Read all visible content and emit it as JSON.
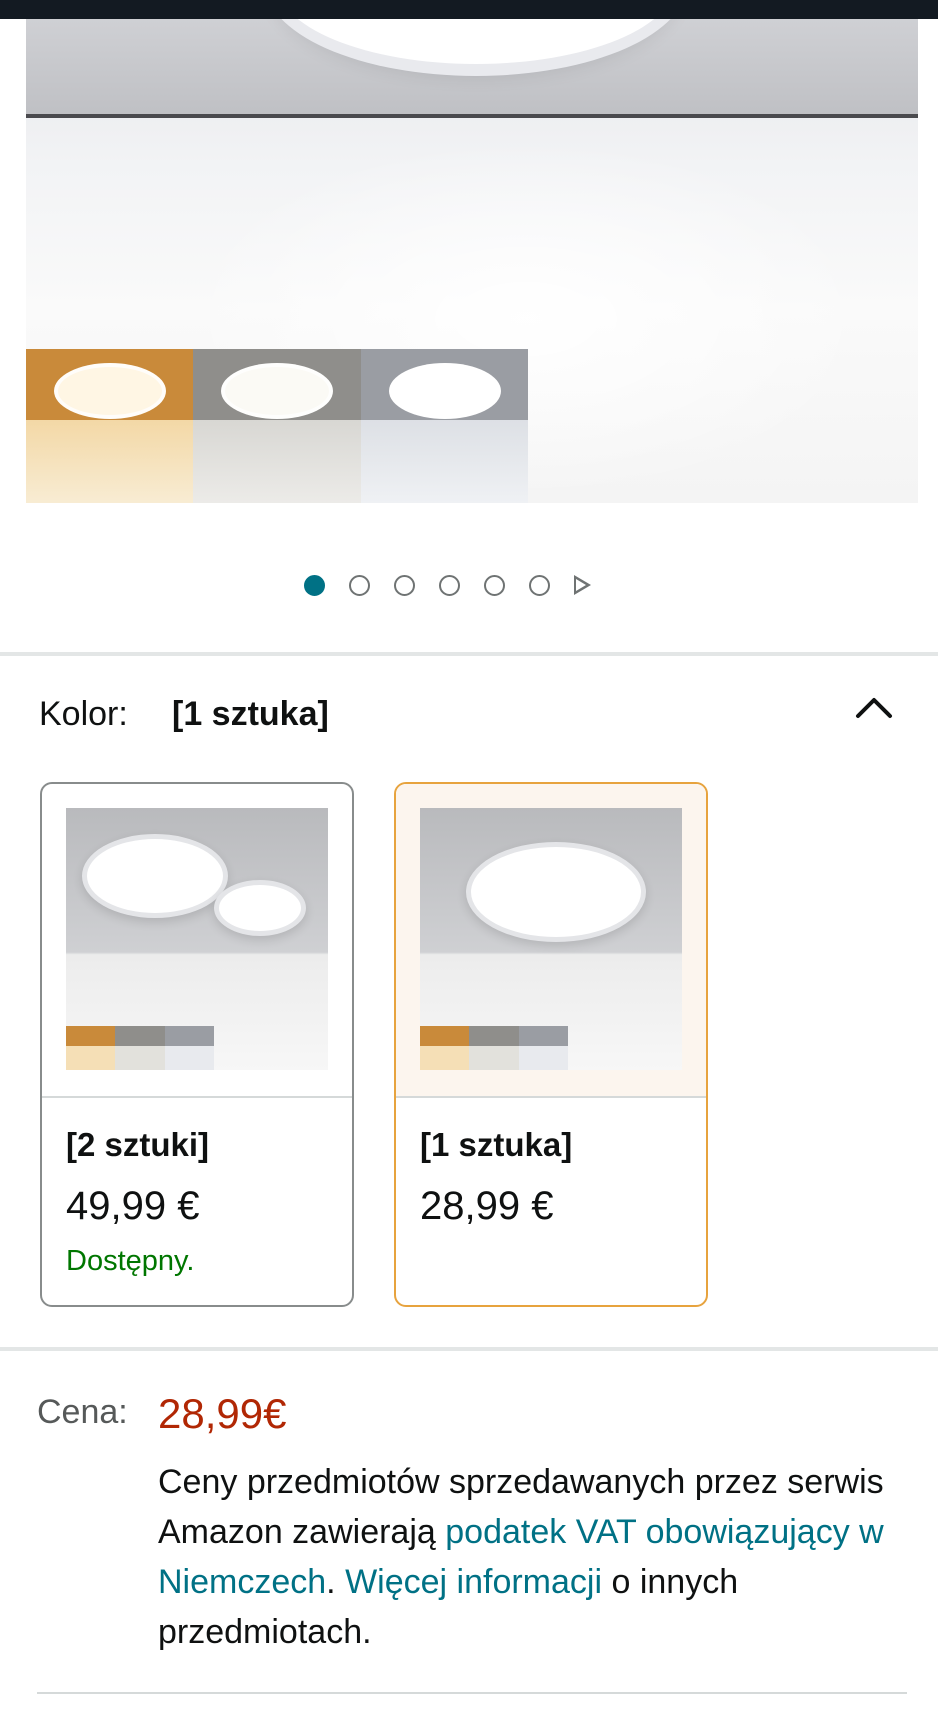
{
  "gallery": {
    "image_count": 7,
    "active_index": 0
  },
  "variant_selector": {
    "label": "Kolor:",
    "selected_value": "[1 sztuka]",
    "options": [
      {
        "title": "[2 sztuki]",
        "price": "49,99 €",
        "availability": "Dostępny.",
        "selected": false
      },
      {
        "title": "[1 sztuka]",
        "price": "28,99 €",
        "availability": "",
        "selected": true
      }
    ]
  },
  "price_block": {
    "label": "Cena:",
    "price": "28,99€",
    "vat_text_1": "Ceny przedmiotów sprzedawanych przez serwis Amazon zawierają ",
    "vat_link": "podatek VAT obowiązujący w Niemczech",
    "vat_text_2": ". ",
    "more_link": "Więcej informacji",
    "vat_text_3": " o innych przedmiotach."
  },
  "colors": {
    "accent": "#007185",
    "price": "#b12704",
    "available": "#007600",
    "selected_border": "#e7a33e",
    "top_bar": "#131a22"
  },
  "icons": [
    "chevron-up-icon",
    "next-arrow-icon"
  ]
}
